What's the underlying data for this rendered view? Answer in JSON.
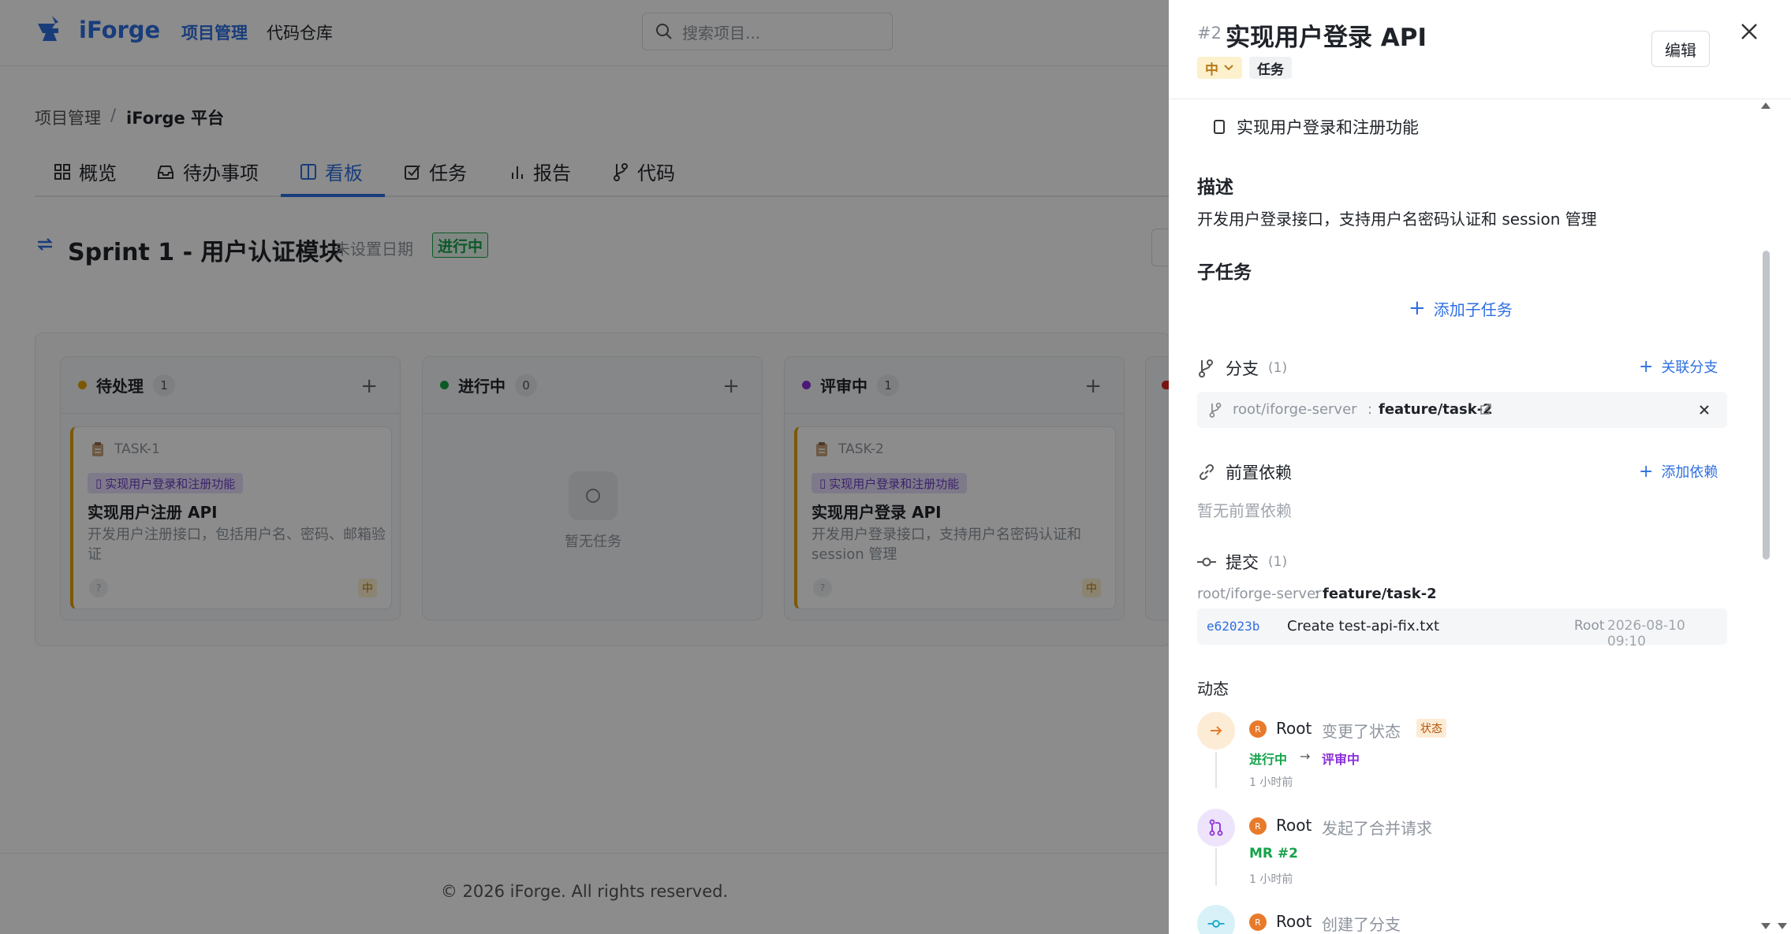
{
  "app": {
    "name": "iForge",
    "nav": [
      "项目管理",
      "代码仓库"
    ],
    "search_placeholder": "搜索项目..."
  },
  "breadcrumb": {
    "root": "项目管理",
    "sep": "/",
    "current": "iForge 平台"
  },
  "tabs": [
    {
      "label": "概览",
      "icon": "grid-icon"
    },
    {
      "label": "待办事项",
      "icon": "inbox-icon"
    },
    {
      "label": "看板",
      "icon": "columns-icon",
      "active": true
    },
    {
      "label": "任务",
      "icon": "checkbox-icon"
    },
    {
      "label": "报告",
      "icon": "bar-chart-icon"
    },
    {
      "label": "代码",
      "icon": "branch-icon"
    }
  ],
  "sprint": {
    "title": "Sprint 1 - 用户认证模块",
    "date": "未设置日期",
    "status": "进行中"
  },
  "columns": [
    {
      "name": "待处理",
      "count": "1",
      "color": "#e3a008"
    },
    {
      "name": "进行中",
      "count": "0",
      "color": "#16a34a",
      "empty": "暂无任务"
    },
    {
      "name": "评审中",
      "count": "1",
      "color": "#8b2fd9"
    }
  ],
  "cards": [
    {
      "id": "TASK-1",
      "epic": "实现用户登录和注册功能",
      "title": "实现用户注册 API",
      "desc": "开发用户注册接口，包括用户名、密码、邮箱验证",
      "assignee": "?",
      "priority": "中"
    },
    {
      "id": "TASK-2",
      "epic": "实现用户登录和注册功能",
      "title": "实现用户登录 API",
      "desc": "开发用户登录接口，支持用户名密码认证和 session 管理",
      "assignee": "?",
      "priority": "中"
    }
  ],
  "footer": "© 2026 iForge. All rights reserved.",
  "panel": {
    "number": "#2",
    "title": "实现用户登录 API",
    "priority": "中",
    "type": "任务",
    "edit": "编辑",
    "epic": "实现用户登录和注册功能",
    "description_heading": "描述",
    "description": "开发用户登录接口，支持用户名密码认证和 session 管理",
    "subtasks_heading": "子任务",
    "add_subtask": "添加子任务",
    "branches": {
      "heading": "分支",
      "count": "(1)",
      "action": "关联分支",
      "repo": "root/iforge-server",
      "colon": ":",
      "branch": "feature/task-2"
    },
    "deps": {
      "heading": "前置依赖",
      "action": "添加依赖",
      "empty": "暂无前置依赖"
    },
    "commits": {
      "heading": "提交",
      "count": "(1)",
      "repo": "root/iforge-server",
      "colon": ":",
      "branch": "feature/task-2",
      "sha": "e62023b",
      "message": "Create test-api-fix.txt",
      "author": "Root",
      "time": "2026-08-10 09:10"
    },
    "activity": {
      "heading": "动态",
      "items": [
        {
          "user": "Root",
          "avatar": "R",
          "action": "变更了状态",
          "tag": "状态",
          "from": "进行中",
          "arrow": "→",
          "to": "评审中",
          "time": "1 小时前"
        },
        {
          "user": "Root",
          "avatar": "R",
          "action": "发起了合并请求",
          "mr": "MR #2",
          "time": "1 小时前"
        },
        {
          "user": "Root",
          "avatar": "R",
          "action": "创建了分支"
        }
      ]
    }
  }
}
